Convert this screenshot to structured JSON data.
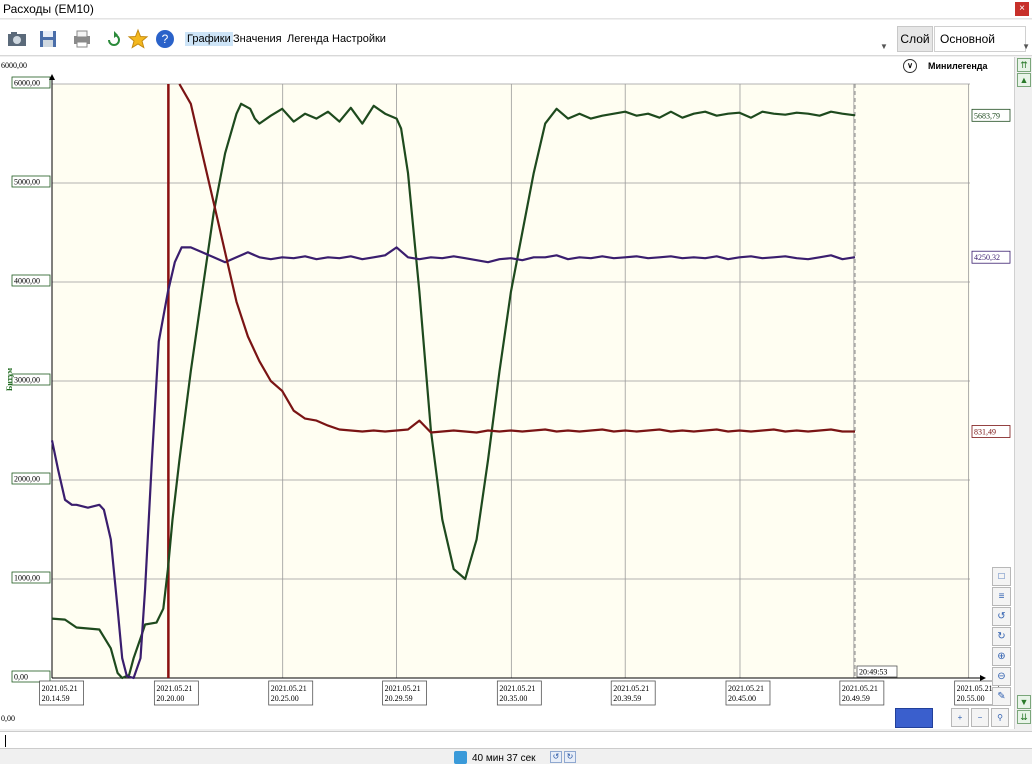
{
  "window": {
    "title": "Расходы (EM10)",
    "close_label": "×"
  },
  "toolbar": {
    "tabs": [
      "Графики",
      "Значения",
      "Легенда",
      "Настройки"
    ],
    "active_tab": 0,
    "icons": [
      "camera-icon",
      "save-icon",
      "print-icon",
      "refresh-icon",
      "star-icon",
      "help-icon"
    ],
    "layer_label": "Слой",
    "layer_value": "Основной"
  },
  "minilegend": {
    "label": "Минилегенда"
  },
  "colors": {
    "background": "#fffef2",
    "grid": "#9a9a9a",
    "green": "#1e4a1e",
    "purple": "#3a1e6e",
    "red": "#7a1414",
    "cursor": "#8a1010"
  },
  "chart_data": {
    "type": "line",
    "ylabel": "Битум",
    "ylim": [
      0,
      6000
    ],
    "ytick_labels": [
      "0,00",
      "1000,00",
      "2000,00",
      "3000,00",
      "4000,00",
      "5000,00",
      "6000,00"
    ],
    "y_top_outer": "6000,00",
    "y_bottom_outer": "0,00",
    "xlim": [
      -0.07,
      40.08
    ],
    "x_unit": "minutes",
    "xticks": [
      {
        "date": "2021.05.21",
        "time": "20.14.59",
        "x": 0
      },
      {
        "date": "2021.05.21",
        "time": "20.20.00",
        "x": 5.02
      },
      {
        "date": "2021.05.21",
        "time": "20.25.00",
        "x": 10.02
      },
      {
        "date": "2021.05.21",
        "time": "20.29.59",
        "x": 15.0
      },
      {
        "date": "2021.05.21",
        "time": "20.35.00",
        "x": 20.02
      },
      {
        "date": "2021.05.21",
        "time": "20.39.59",
        "x": 25.0
      },
      {
        "date": "2021.05.21",
        "time": "20.45.00",
        "x": 30.02
      },
      {
        "date": "2021.05.21",
        "time": "20.49.59",
        "x": 35.0
      },
      {
        "date": "2021.05.21",
        "time": "20.55.00",
        "x": 40.02
      }
    ],
    "cursor_x": 5.02,
    "end_marker": {
      "x": 35.05,
      "label": "20:49:53"
    },
    "series": [
      {
        "color": "#1e4a1e",
        "last_value_label": "5683,79",
        "points": [
          [
            -0.07,
            600
          ],
          [
            0.5,
            590
          ],
          [
            1,
            510
          ],
          [
            1.5,
            500
          ],
          [
            2,
            490
          ],
          [
            2.5,
            300
          ],
          [
            2.8,
            50
          ],
          [
            3,
            0
          ],
          [
            3.3,
            30
          ],
          [
            3.5,
            200
          ],
          [
            3.8,
            400
          ],
          [
            4,
            540
          ],
          [
            4.5,
            560
          ],
          [
            4.8,
            700
          ],
          [
            5,
            1100
          ],
          [
            5.2,
            1600
          ],
          [
            5.5,
            2200
          ],
          [
            6,
            3100
          ],
          [
            6.5,
            3900
          ],
          [
            7,
            4700
          ],
          [
            7.5,
            5300
          ],
          [
            8,
            5700
          ],
          [
            8.2,
            5800
          ],
          [
            8.6,
            5750
          ],
          [
            8.8,
            5650
          ],
          [
            9,
            5600
          ],
          [
            9.5,
            5680
          ],
          [
            10,
            5750
          ],
          [
            10.5,
            5620
          ],
          [
            11,
            5700
          ],
          [
            11.5,
            5650
          ],
          [
            12,
            5720
          ],
          [
            12.5,
            5620
          ],
          [
            13,
            5760
          ],
          [
            13.5,
            5600
          ],
          [
            14,
            5780
          ],
          [
            14.5,
            5700
          ],
          [
            15,
            5650
          ],
          [
            15.2,
            5550
          ],
          [
            15.5,
            5100
          ],
          [
            16,
            3900
          ],
          [
            16.5,
            2500
          ],
          [
            17,
            1600
          ],
          [
            17.5,
            1100
          ],
          [
            18,
            1000
          ],
          [
            18.5,
            1400
          ],
          [
            19,
            2200
          ],
          [
            19.5,
            3100
          ],
          [
            20,
            3900
          ],
          [
            20.5,
            4500
          ],
          [
            21,
            5100
          ],
          [
            21.5,
            5600
          ],
          [
            22,
            5750
          ],
          [
            22.5,
            5650
          ],
          [
            23,
            5700
          ],
          [
            23.5,
            5650
          ],
          [
            24,
            5680
          ],
          [
            24.5,
            5700
          ],
          [
            25,
            5720
          ],
          [
            25.5,
            5680
          ],
          [
            26,
            5700
          ],
          [
            26.5,
            5660
          ],
          [
            27,
            5720
          ],
          [
            27.5,
            5660
          ],
          [
            28,
            5700
          ],
          [
            28.5,
            5720
          ],
          [
            29,
            5680
          ],
          [
            29.5,
            5700
          ],
          [
            30,
            5710
          ],
          [
            30.5,
            5660
          ],
          [
            31,
            5720
          ],
          [
            31.5,
            5700
          ],
          [
            32,
            5690
          ],
          [
            32.5,
            5710
          ],
          [
            33,
            5700
          ],
          [
            33.5,
            5680
          ],
          [
            34,
            5720
          ],
          [
            34.5,
            5700
          ],
          [
            35.05,
            5683.79
          ]
        ]
      },
      {
        "color": "#3a1e6e",
        "last_value_label": "4250,32",
        "points": [
          [
            -0.07,
            2400
          ],
          [
            0.2,
            2100
          ],
          [
            0.5,
            1800
          ],
          [
            0.8,
            1750
          ],
          [
            1,
            1750
          ],
          [
            1.5,
            1720
          ],
          [
            2,
            1750
          ],
          [
            2.2,
            1700
          ],
          [
            2.5,
            1400
          ],
          [
            2.8,
            700
          ],
          [
            3,
            200
          ],
          [
            3.2,
            20
          ],
          [
            3.5,
            0
          ],
          [
            3.8,
            200
          ],
          [
            4,
            900
          ],
          [
            4.3,
            2200
          ],
          [
            4.6,
            3400
          ],
          [
            5,
            3900
          ],
          [
            5.3,
            4200
          ],
          [
            5.6,
            4350
          ],
          [
            6,
            4350
          ],
          [
            6.5,
            4300
          ],
          [
            7,
            4250
          ],
          [
            7.5,
            4200
          ],
          [
            8,
            4250
          ],
          [
            8.5,
            4300
          ],
          [
            9,
            4250
          ],
          [
            9.5,
            4230
          ],
          [
            10,
            4250
          ],
          [
            10.5,
            4240
          ],
          [
            11,
            4260
          ],
          [
            11.5,
            4230
          ],
          [
            12,
            4250
          ],
          [
            12.5,
            4240
          ],
          [
            13,
            4260
          ],
          [
            13.5,
            4230
          ],
          [
            14,
            4250
          ],
          [
            14.5,
            4270
          ],
          [
            15,
            4350
          ],
          [
            15.5,
            4250
          ],
          [
            16,
            4230
          ],
          [
            16.5,
            4250
          ],
          [
            17,
            4240
          ],
          [
            17.5,
            4260
          ],
          [
            18,
            4240
          ],
          [
            18.5,
            4220
          ],
          [
            19,
            4200
          ],
          [
            19.5,
            4230
          ],
          [
            20,
            4240
          ],
          [
            20.5,
            4220
          ],
          [
            21,
            4250
          ],
          [
            21.5,
            4250
          ],
          [
            22,
            4270
          ],
          [
            22.5,
            4230
          ],
          [
            23,
            4250
          ],
          [
            23.5,
            4240
          ],
          [
            24,
            4260
          ],
          [
            24.5,
            4240
          ],
          [
            25,
            4250
          ],
          [
            25.5,
            4260
          ],
          [
            26,
            4240
          ],
          [
            26.5,
            4250
          ],
          [
            27,
            4260
          ],
          [
            27.5,
            4240
          ],
          [
            28,
            4250
          ],
          [
            28.5,
            4240
          ],
          [
            29,
            4260
          ],
          [
            29.5,
            4230
          ],
          [
            30,
            4250
          ],
          [
            30.5,
            4260
          ],
          [
            31,
            4240
          ],
          [
            31.5,
            4250
          ],
          [
            32,
            4260
          ],
          [
            32.5,
            4240
          ],
          [
            33,
            4230
          ],
          [
            33.5,
            4250
          ],
          [
            34,
            4270
          ],
          [
            34.5,
            4230
          ],
          [
            35.05,
            4250.32
          ]
        ]
      },
      {
        "color": "#7a1414",
        "last_value_label": "831,49",
        "points": [
          [
            5.5,
            6000
          ],
          [
            6,
            5800
          ],
          [
            6.5,
            5300
          ],
          [
            7,
            4800
          ],
          [
            7.5,
            4300
          ],
          [
            8,
            3800
          ],
          [
            8.5,
            3450
          ],
          [
            9,
            3200
          ],
          [
            9.5,
            3000
          ],
          [
            10,
            2900
          ],
          [
            10.5,
            2700
          ],
          [
            11,
            2620
          ],
          [
            11.5,
            2600
          ],
          [
            12,
            2550
          ],
          [
            12.5,
            2510
          ],
          [
            13,
            2500
          ],
          [
            13.5,
            2490
          ],
          [
            14,
            2500
          ],
          [
            14.5,
            2490
          ],
          [
            15,
            2500
          ],
          [
            15.5,
            2510
          ],
          [
            16,
            2600
          ],
          [
            16.5,
            2480
          ],
          [
            17,
            2490
          ],
          [
            17.5,
            2500
          ],
          [
            18,
            2490
          ],
          [
            18.5,
            2480
          ],
          [
            19,
            2500
          ],
          [
            19.5,
            2490
          ],
          [
            20,
            2500
          ],
          [
            20.5,
            2490
          ],
          [
            21,
            2500
          ],
          [
            21.5,
            2510
          ],
          [
            22,
            2490
          ],
          [
            22.5,
            2500
          ],
          [
            23,
            2490
          ],
          [
            23.5,
            2500
          ],
          [
            24,
            2510
          ],
          [
            24.5,
            2490
          ],
          [
            25,
            2500
          ],
          [
            25.5,
            2490
          ],
          [
            26,
            2500
          ],
          [
            26.5,
            2510
          ],
          [
            27,
            2490
          ],
          [
            27.5,
            2500
          ],
          [
            28,
            2490
          ],
          [
            28.5,
            2500
          ],
          [
            29,
            2510
          ],
          [
            29.5,
            2490
          ],
          [
            30,
            2500
          ],
          [
            30.5,
            2490
          ],
          [
            31,
            2500
          ],
          [
            31.5,
            2510
          ],
          [
            32,
            2490
          ],
          [
            32.5,
            2500
          ],
          [
            33,
            2490
          ],
          [
            33.5,
            2500
          ],
          [
            34,
            2510
          ],
          [
            34.5,
            2490
          ],
          [
            35.05,
            2490
          ]
        ]
      }
    ],
    "grid": true,
    "legend": "right"
  },
  "scroll": {
    "up_label": "▲",
    "down_label": "▼",
    "top_label": "⇈",
    "bottom_label": "⇊"
  },
  "controls": {
    "zoom_in": "+",
    "zoom_out": "−"
  },
  "status": {
    "elapsed": "40 мин 37 сек"
  }
}
